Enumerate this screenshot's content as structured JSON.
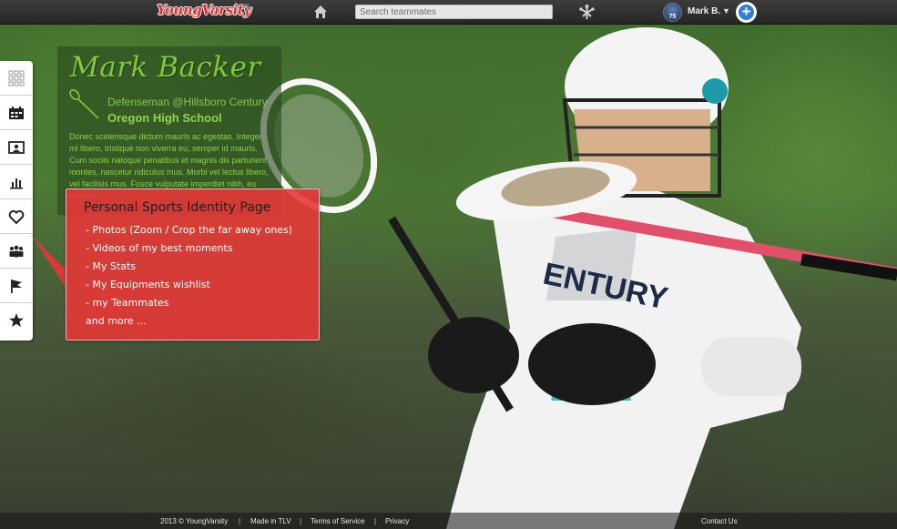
{
  "topbar": {
    "logo": "YoungVarsity",
    "logo_tm": "TM",
    "home_icon": "home-icon",
    "search_placeholder": "Search teammates",
    "network_icon": "network-icon",
    "avatar_number": "75",
    "user_name": "Mark B.",
    "caret": "▼",
    "add_label": "+"
  },
  "sidebar": {
    "items": [
      {
        "name": "grid",
        "icon": "grid-icon"
      },
      {
        "name": "schedule",
        "icon": "calendar-icon"
      },
      {
        "name": "profile-card",
        "icon": "id-card-icon"
      },
      {
        "name": "stats",
        "icon": "bar-chart-icon"
      },
      {
        "name": "wishlist",
        "icon": "heart-icon"
      },
      {
        "name": "teammates",
        "icon": "group-icon"
      },
      {
        "name": "teams",
        "icon": "flag-icon"
      },
      {
        "name": "favorites",
        "icon": "star-icon"
      }
    ]
  },
  "profile": {
    "name": "Mark Backer",
    "position": "Defenseman @Hillsboro Century",
    "school": "Oregon High School",
    "bio": "Donec scelerisque dictum mauris ac egestas. Integer mi libero, tristique non viverra eu, semper id mauris. Cum sociis natoque penatibus et magnis dis parturient montes, nascetur ridiculus mus. Morbi vel lectus libero, vel facilisis mus. Fusce vulputate imperdiet nibh, eu semper..."
  },
  "callout": {
    "title": "Personal Sports Identity Page",
    "items": [
      "- Photos (Zoom / Crop the far away ones)",
      "- Videos of my best moments",
      "- My Stats",
      "- My Equipments wishlist",
      "- my Teammates",
      "and more ..."
    ]
  },
  "footer": {
    "copyright": "2013 © YoungVarsity",
    "made_in": "Made in TLV",
    "terms": "Terms of Service",
    "privacy": "Privacy",
    "contact": "Contact Us",
    "separator": "|"
  },
  "colors": {
    "accent_green": "#7fc93a",
    "callout_red": "#e63737",
    "logo_red": "#e52d2d",
    "plus_blue": "#2f7fd8"
  }
}
